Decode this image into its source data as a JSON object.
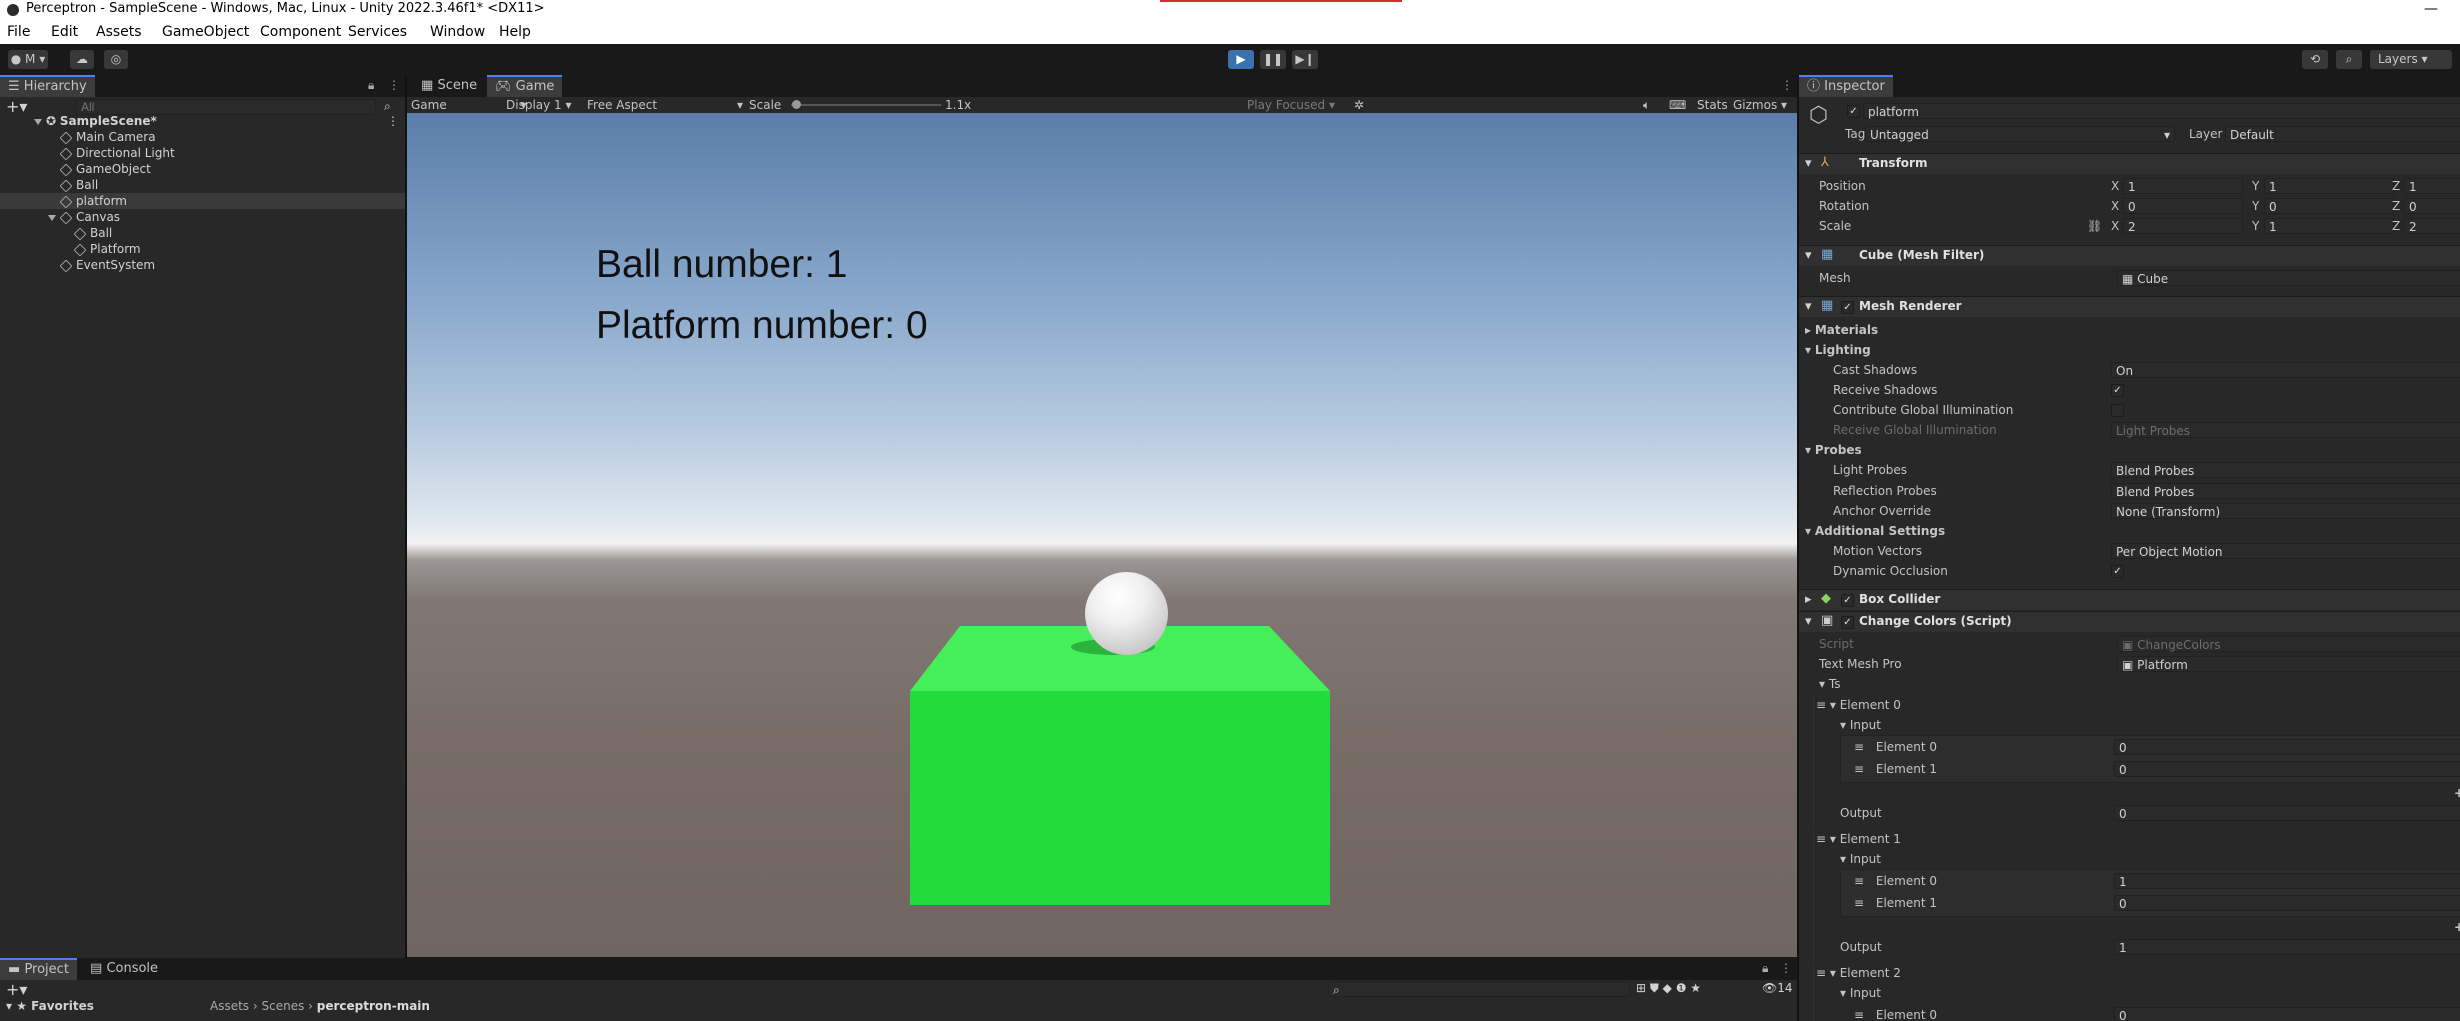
{
  "window": {
    "title": "Perceptron - SampleScene - Windows, Mac, Linux - Unity 2022.3.46f1* <DX11>",
    "minimize": "—"
  },
  "menu": [
    "File",
    "Edit",
    "Assets",
    "GameObject",
    "Component",
    "Services",
    "Window",
    "Help"
  ],
  "toolbar": {
    "account": "M",
    "layers": "Layers"
  },
  "hierarchy": {
    "tab": "Hierarchy",
    "search_placeholder": "All",
    "scene": "SampleScene*",
    "items": [
      {
        "label": "Main Camera"
      },
      {
        "label": "Directional Light"
      },
      {
        "label": "GameObject"
      },
      {
        "label": "Ball"
      },
      {
        "label": "platform"
      },
      {
        "label": "Canvas"
      },
      {
        "label": "Ball"
      },
      {
        "label": "Platform"
      },
      {
        "label": "EventSystem"
      }
    ]
  },
  "game": {
    "tabs": [
      "Scene",
      "Game"
    ],
    "mode": "Game",
    "display": "Display 1",
    "aspect": "Free Aspect",
    "scale_label": "Scale",
    "scale_value": "1.1x",
    "play_focused": "Play Focused",
    "stats": "Stats",
    "gizmos": "Gizmos",
    "hud_ball": "Ball number: 1",
    "hud_platform": "Platform number: 0"
  },
  "bottom": {
    "tabs": [
      "Project",
      "Console"
    ],
    "favorites": "Favorites",
    "breadcrumb": [
      "Assets",
      "Scenes",
      "perceptron-main"
    ],
    "count": "14"
  },
  "inspector": {
    "tab": "Inspector",
    "object_name": "platform",
    "tag_label": "Tag",
    "tag_value": "Untagged",
    "layer_label": "Layer",
    "layer_value": "Default",
    "transform": {
      "title": "Transform",
      "position_label": "Position",
      "position": [
        "1",
        "1",
        "1"
      ],
      "rotation_label": "Rotation",
      "rotation": [
        "0",
        "0",
        "0"
      ],
      "scale_label": "Scale",
      "scale": [
        "2",
        "1",
        "2"
      ]
    },
    "mesh_filter": {
      "title": "Cube (Mesh Filter)",
      "mesh_label": "Mesh",
      "mesh_value": "Cube"
    },
    "mesh_renderer": {
      "title": "Mesh Renderer",
      "materials": "Materials",
      "lighting": "Lighting",
      "cast_shadows_label": "Cast Shadows",
      "cast_shadows": "On",
      "receive_shadows_label": "Receive Shadows",
      "contribute_gi_label": "Contribute Global Illumination",
      "receive_gi_label": "Receive Global Illumination",
      "receive_gi": "Light Probes",
      "probes": "Probes",
      "light_probes_label": "Light Probes",
      "light_probes": "Blend Probes",
      "reflection_probes_label": "Reflection Probes",
      "reflection_probes": "Blend Probes",
      "anchor_label": "Anchor Override",
      "anchor": "None (Transform)",
      "additional": "Additional Settings",
      "motion_label": "Motion Vectors",
      "motion": "Per Object Motion",
      "dyn_occ_label": "Dynamic Occlusion"
    },
    "box_collider": {
      "title": "Box Collider"
    },
    "change_colors": {
      "title": "Change Colors (Script)",
      "script_label": "Script",
      "script_value": "ChangeColors",
      "tmp_label": "Text Mesh Pro",
      "tmp_value": "Platform",
      "ts_label": "Ts",
      "elements": [
        {
          "label": "Element 0",
          "input_label": "Input",
          "inputs": [
            {
              "label": "Element 0",
              "value": "0"
            },
            {
              "label": "Element 1",
              "value": "0"
            }
          ],
          "output_label": "Output",
          "output": "0"
        },
        {
          "label": "Element 1",
          "input_label": "Input",
          "inputs": [
            {
              "label": "Element 0",
              "value": "1"
            },
            {
              "label": "Element 1",
              "value": "0"
            }
          ],
          "output_label": "Output",
          "output": "1"
        },
        {
          "label": "Element 2",
          "input_label": "Input",
          "inputs": [
            {
              "label": "Element 0",
              "value": "0"
            }
          ]
        }
      ]
    }
  },
  "colors": {
    "accent": "#4c7fff",
    "platform_green": "#22dc3c",
    "play_active": "#3a72b0"
  }
}
